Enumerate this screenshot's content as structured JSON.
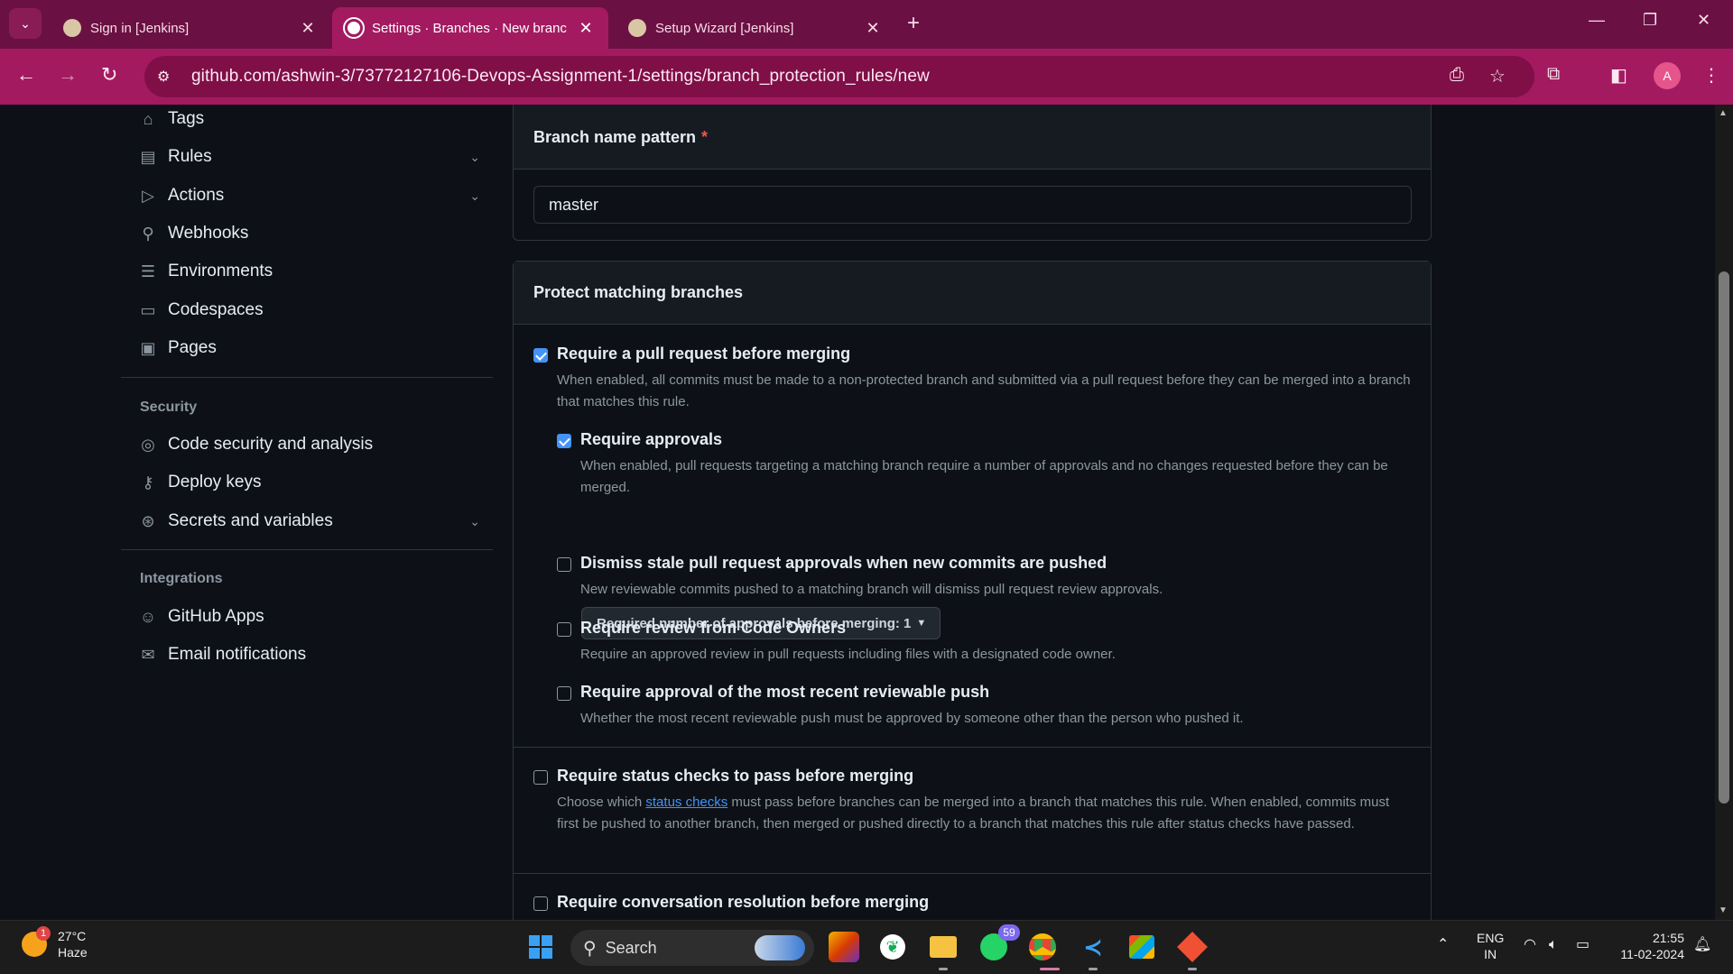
{
  "browser": {
    "tabs": [
      {
        "title": "Sign in [Jenkins]",
        "active": false
      },
      {
        "title": "Settings · Branches · New branch p",
        "active": true
      },
      {
        "title": "Setup Wizard [Jenkins]",
        "active": false
      }
    ],
    "url": "github.com/ashwin-3/73772127106-Devops-Assignment-1/settings/branch_protection_rules/new",
    "profile_letter": "A"
  },
  "sidebar": {
    "items_top": [
      {
        "label": "Tags",
        "icon": "tag-icon",
        "has_chevron": false
      },
      {
        "label": "Rules",
        "icon": "rules-icon",
        "has_chevron": true
      },
      {
        "label": "Actions",
        "icon": "play-icon",
        "has_chevron": true
      },
      {
        "label": "Webhooks",
        "icon": "webhook-icon",
        "has_chevron": false
      },
      {
        "label": "Environments",
        "icon": "server-icon",
        "has_chevron": false
      },
      {
        "label": "Codespaces",
        "icon": "codespaces-icon",
        "has_chevron": false
      },
      {
        "label": "Pages",
        "icon": "browser-icon",
        "has_chevron": false
      }
    ],
    "security_heading": "Security",
    "security_items": [
      {
        "label": "Code security and analysis",
        "icon": "codescan-icon",
        "has_chevron": false
      },
      {
        "label": "Deploy keys",
        "icon": "key-icon",
        "has_chevron": false
      },
      {
        "label": "Secrets and variables",
        "icon": "asterisk-icon",
        "has_chevron": true
      }
    ],
    "integrations_heading": "Integrations",
    "integrations_items": [
      {
        "label": "GitHub Apps",
        "icon": "hubot-icon",
        "has_chevron": false
      },
      {
        "label": "Email notifications",
        "icon": "mail-icon",
        "has_chevron": false
      }
    ]
  },
  "branch_pattern": {
    "heading": "Branch name pattern",
    "required_mark": "*",
    "value": "master"
  },
  "protect": {
    "heading": "Protect matching branches",
    "require_pr": {
      "label": "Require a pull request before merging",
      "desc": "When enabled, all commits must be made to a non-protected branch and submitted via a pull request before they can be merged into a branch that matches this rule.",
      "checked": true
    },
    "require_approvals": {
      "label": "Require approvals",
      "desc": "When enabled, pull requests targeting a matching branch require a number of approvals and no changes requested before they can be merged.",
      "checked": true,
      "select_label": "Required number of approvals before merging: 1"
    },
    "dismiss_stale": {
      "label": "Dismiss stale pull request approvals when new commits are pushed",
      "desc": "New reviewable commits pushed to a matching branch will dismiss pull request review approvals.",
      "checked": false
    },
    "code_owners": {
      "label": "Require review from Code Owners",
      "desc": "Require an approved review in pull requests including files with a designated code owner.",
      "checked": false
    },
    "recent_push": {
      "label": "Require approval of the most recent reviewable push",
      "desc": "Whether the most recent reviewable push must be approved by someone other than the person who pushed it.",
      "checked": false
    },
    "status_checks": {
      "label": "Require status checks to pass before merging",
      "desc_before": "Choose which ",
      "desc_link": "status checks",
      "desc_after": " must pass before branches can be merged into a branch that matches this rule. When enabled, commits must first be pushed to another branch, then merged or pushed directly to a branch that matches this rule after status checks have passed.",
      "checked": false
    },
    "conversation": {
      "label": "Require conversation resolution before merging",
      "checked": false
    }
  },
  "taskbar": {
    "weather_temp": "27°C",
    "weather_desc": "Haze",
    "weather_badge": "1",
    "search_label": "Search",
    "whatsapp_badge": "59",
    "lang_line1": "ENG",
    "lang_line2": "IN",
    "time": "21:55",
    "date": "11-02-2024"
  }
}
